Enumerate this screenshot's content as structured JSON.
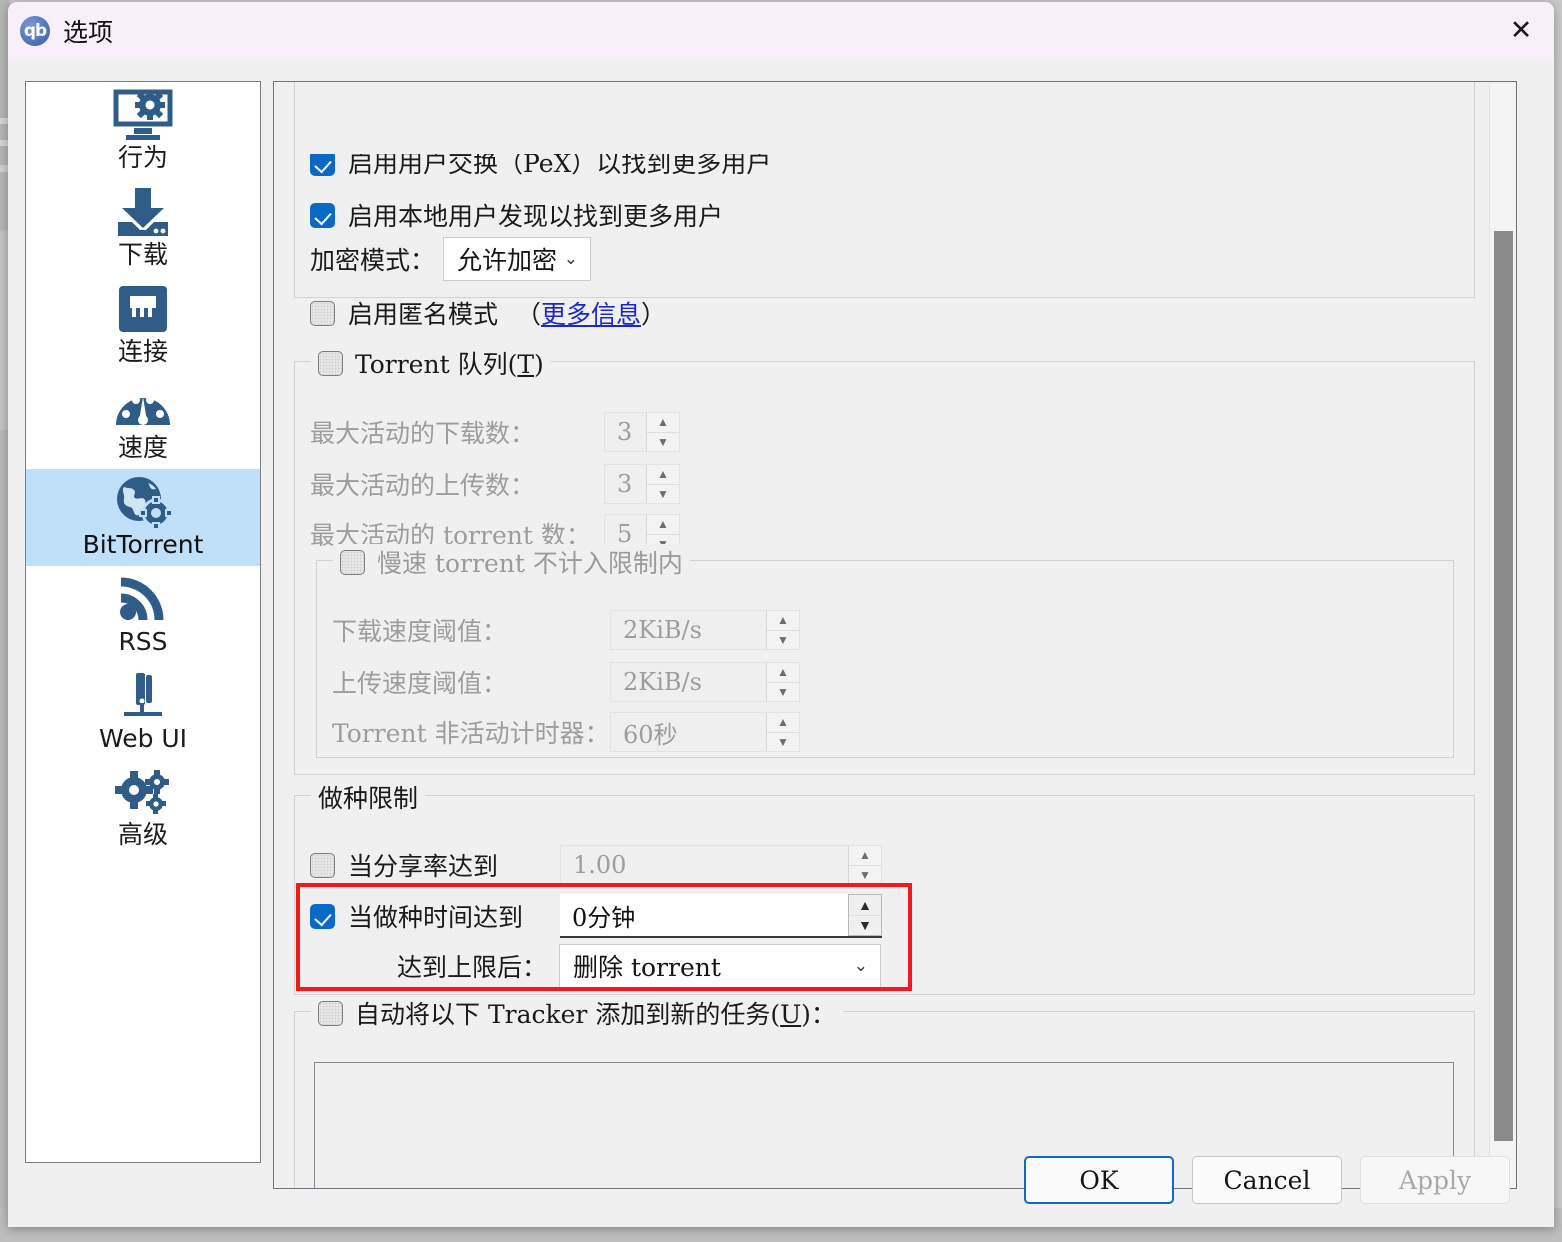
{
  "window": {
    "title": "选项",
    "logo_text": "qb",
    "close_icon": "✕"
  },
  "sidebar": {
    "items": [
      {
        "label": "行为",
        "icon": "monitor-gear-icon",
        "selected": false
      },
      {
        "label": "下载",
        "icon": "download-icon",
        "selected": false
      },
      {
        "label": "连接",
        "icon": "network-port-icon",
        "selected": false
      },
      {
        "label": "速度",
        "icon": "speedometer-icon",
        "selected": false
      },
      {
        "label": "BitTorrent",
        "icon": "globe-gear-icon",
        "selected": true
      },
      {
        "label": "RSS",
        "icon": "rss-icon",
        "selected": false
      },
      {
        "label": "Web UI",
        "icon": "server-icon",
        "selected": false
      },
      {
        "label": "高级",
        "icon": "gears-icon",
        "selected": false
      }
    ]
  },
  "privacy": {
    "pex_label": "启用用户交换（PeX）以找到更多用户",
    "pex_checked": true,
    "lsd_label": "启用本地用户发现以找到更多用户",
    "lsd_checked": true,
    "encryption_label": "加密模式：",
    "encryption_value": "允许加密",
    "anonymous_label": "启用匿名模式",
    "anonymous_checked": false,
    "more_info_open": "（",
    "more_info_link": "更多信息",
    "more_info_close": "）"
  },
  "queue": {
    "title": "Torrent 队列(T)",
    "title_mnemonic": "T",
    "checked": false,
    "max_active_downloads_label": "最大活动的下载数：",
    "max_active_downloads_value": "3",
    "max_active_uploads_label": "最大活动的上传数：",
    "max_active_uploads_value": "3",
    "max_active_torrents_label": "最大活动的 torrent 数：",
    "max_active_torrents_value": "5",
    "slow_torrents": {
      "title": "慢速 torrent 不计入限制内",
      "checked": false,
      "download_rate_label": "下载速度阈值：",
      "download_rate_value": "2KiB/s",
      "upload_rate_label": "上传速度阈值：",
      "upload_rate_value": "2KiB/s",
      "inactivity_label": "Torrent 非活动计时器：",
      "inactivity_value": "60秒"
    }
  },
  "seeding": {
    "title": "做种限制",
    "ratio_label": "当分享率达到",
    "ratio_checked": false,
    "ratio_value": "1.00",
    "time_label": "当做种时间达到",
    "time_checked": true,
    "time_value": "0分钟",
    "action_label": "达到上限后：",
    "action_value": "删除 torrent",
    "highlight_color": "#f01c1c"
  },
  "trackers": {
    "title": "自动将以下 Tracker 添加到新的任务(U)：",
    "title_mnemonic": "U",
    "checked": false,
    "text_value": ""
  },
  "footer": {
    "ok": "OK",
    "cancel": "Cancel",
    "apply": "Apply"
  },
  "colors": {
    "accent_blue": "#0a69c8",
    "selected_item": "#bfe0f8",
    "icon_blue": "#2f5d87",
    "highlight_red": "#f01c1c",
    "titlebar": "#f8f0f8"
  }
}
